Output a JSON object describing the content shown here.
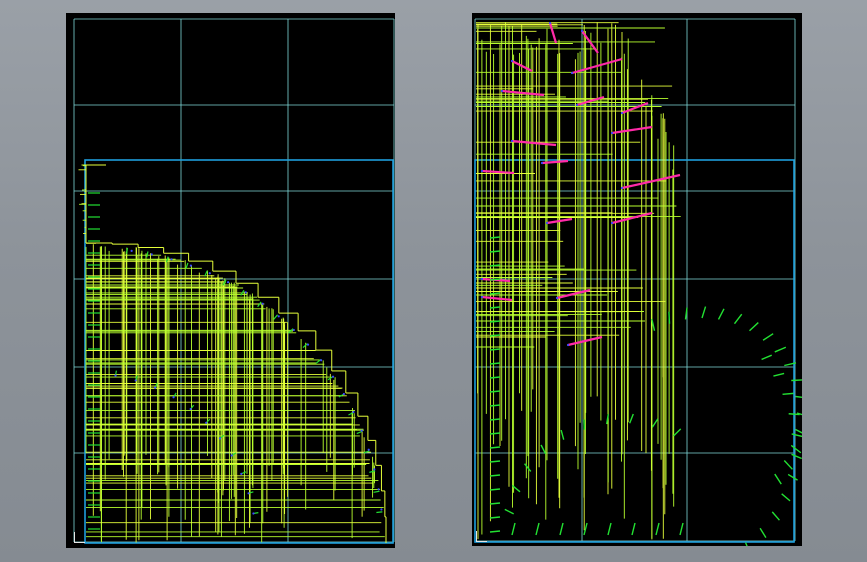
{
  "window": {
    "background_color": "#8e949c",
    "model_space_color": "#000000"
  },
  "colors": {
    "grid": "#7fd8d8",
    "border": "#1e9edb",
    "lines": "#e6ff3a",
    "lines_alt": "#b8ff2e",
    "ticks": "#22e032",
    "accent": "#ff2aa8",
    "points": "#3b4bff"
  },
  "viewports": [
    {
      "id": "left",
      "icon": "ucs-icon"
    },
    {
      "id": "right",
      "icon": "ucs-icon"
    }
  ]
}
